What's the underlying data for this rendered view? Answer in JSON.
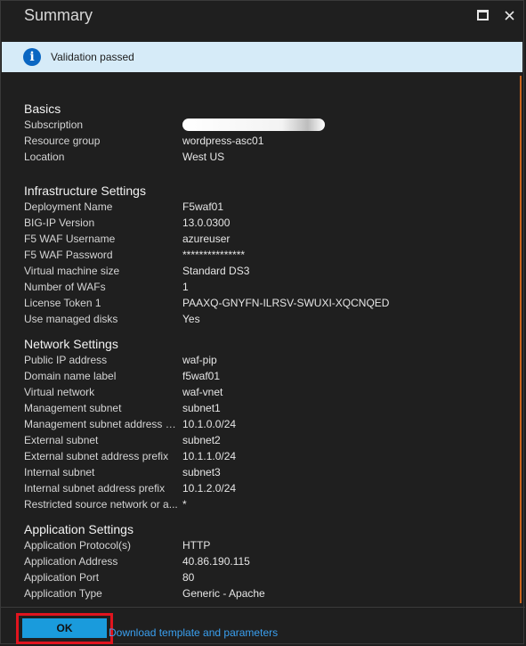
{
  "window": {
    "title": "Summary"
  },
  "banner": {
    "icon": "info-icon",
    "text": "Validation passed"
  },
  "sections": {
    "basics": {
      "title": "Basics",
      "rows": [
        {
          "label": "Subscription",
          "value": ""
        },
        {
          "label": "Resource group",
          "value": "wordpress-asc01"
        },
        {
          "label": "Location",
          "value": "West US"
        }
      ]
    },
    "infrastructure": {
      "title": "Infrastructure Settings",
      "rows": [
        {
          "label": "Deployment Name",
          "value": "F5waf01"
        },
        {
          "label": "BIG-IP Version",
          "value": "13.0.0300"
        },
        {
          "label": "F5 WAF Username",
          "value": "azureuser"
        },
        {
          "label": "F5 WAF Password",
          "value": "***************"
        },
        {
          "label": "Virtual machine size",
          "value": "Standard DS3"
        },
        {
          "label": "Number of WAFs",
          "value": "1"
        },
        {
          "label": "License Token 1",
          "value": "PAAXQ-GNYFN-ILRSV-SWUXI-XQCNQED"
        },
        {
          "label": "Use managed disks",
          "value": "Yes"
        }
      ]
    },
    "network": {
      "title": "Network Settings",
      "rows": [
        {
          "label": "Public IP address",
          "value": "waf-pip"
        },
        {
          "label": "Domain name label",
          "value": "f5waf01"
        },
        {
          "label": "Virtual network",
          "value": "waf-vnet"
        },
        {
          "label": "Management subnet",
          "value": "subnet1"
        },
        {
          "label": "Management subnet address p...",
          "value": "10.1.0.0/24"
        },
        {
          "label": "External subnet",
          "value": "subnet2"
        },
        {
          "label": "External subnet address prefix",
          "value": "10.1.1.0/24"
        },
        {
          "label": "Internal subnet",
          "value": "subnet3"
        },
        {
          "label": "Internal subnet address prefix",
          "value": "10.1.2.0/24"
        },
        {
          "label": "Restricted source network or a...",
          "value": "*"
        }
      ]
    },
    "application": {
      "title": "Application Settings",
      "rows": [
        {
          "label": "Application Protocol(s)",
          "value": "HTTP"
        },
        {
          "label": "Application Address",
          "value": "40.86.190.115"
        },
        {
          "label": "Application Port",
          "value": "80"
        },
        {
          "label": "Application Type",
          "value": "Generic - Apache"
        }
      ]
    }
  },
  "footer": {
    "ok_label": "OK",
    "download_link": "Download template and parameters"
  },
  "colors": {
    "background": "#1f1f1f",
    "banner": "#d6ebf8",
    "info_icon": "#0a66c2",
    "ok_button": "#1a9bdc",
    "highlight_outline": "#e0141e",
    "link": "#3aa0f0",
    "scroll_accent": "#c8651f"
  }
}
